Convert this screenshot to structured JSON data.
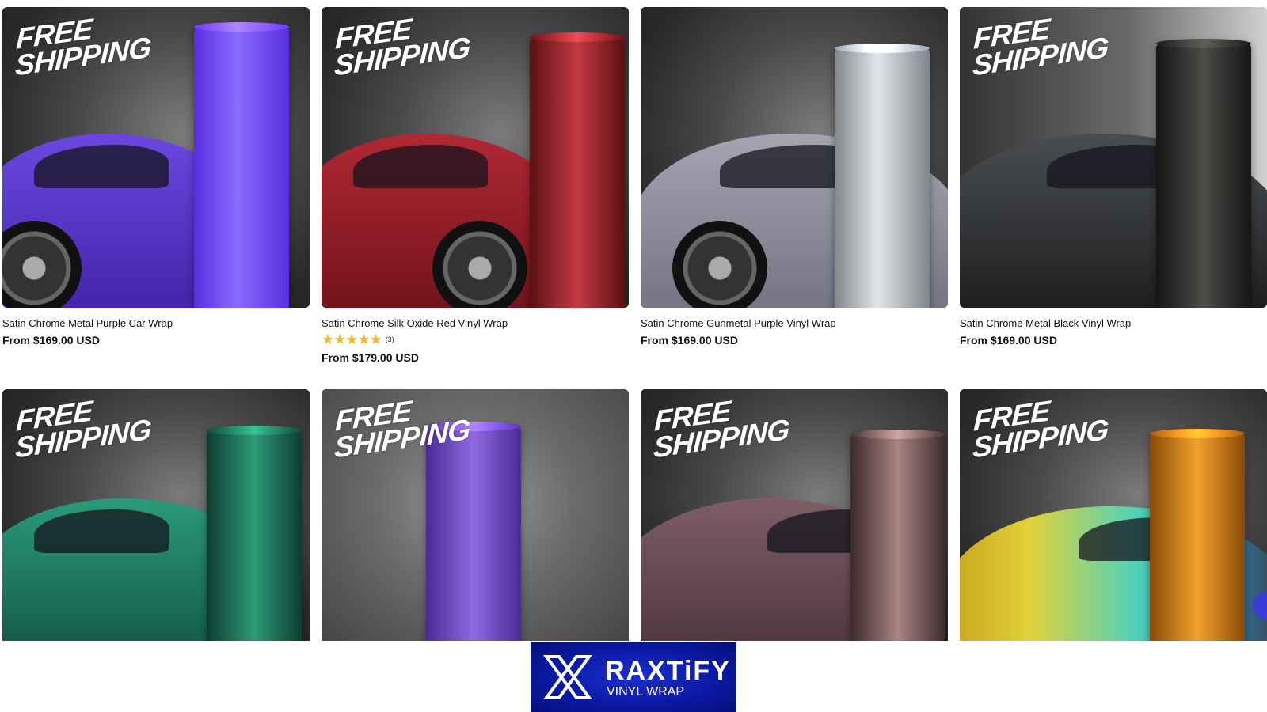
{
  "badge": {
    "line1": "FREE",
    "line2": "SHIPPING"
  },
  "products": [
    {
      "title": "Satin Chrome Metal Purple Car Wrap",
      "price": "From $169.00 USD"
    },
    {
      "title": "Satin Chrome Silk Oxide Red Vinyl Wrap",
      "price": "From $179.00 USD",
      "rating_stars": "★★★★★",
      "rating_count": "(3)",
      "rating": 5
    },
    {
      "title": "Satin Chrome Gunmetal Purple Vinyl Wrap",
      "price": "From $169.00 USD"
    },
    {
      "title": "Satin Chrome Metal Black Vinyl Wrap",
      "price": "From $169.00 USD"
    }
  ],
  "colors": {
    "roll_purple": "#6a3ef0",
    "car_purple": "#5330c8",
    "roll_red": "#8c1d22",
    "car_red": "#9e232c",
    "roll_gunmetal": "#b6bcc2",
    "car_gunmetal": "#8f8fa0",
    "roll_black": "#2a2c2a",
    "car_black": "#3b3d40",
    "roll_green": "#1a6a55",
    "car_green": "#1f7a63",
    "roll_glitter_purple": "#6d44c6",
    "roll_rose": "#8a6a6a",
    "car_rose": "#6f4f58",
    "roll_orange": "#d9840f",
    "car_rainbow": "#4fd2b8",
    "star": "#f6b820",
    "logo_bg": "#0b1aa6"
  },
  "logo": {
    "name": "RAXTiFY",
    "sub": "VINYL WRAP"
  }
}
